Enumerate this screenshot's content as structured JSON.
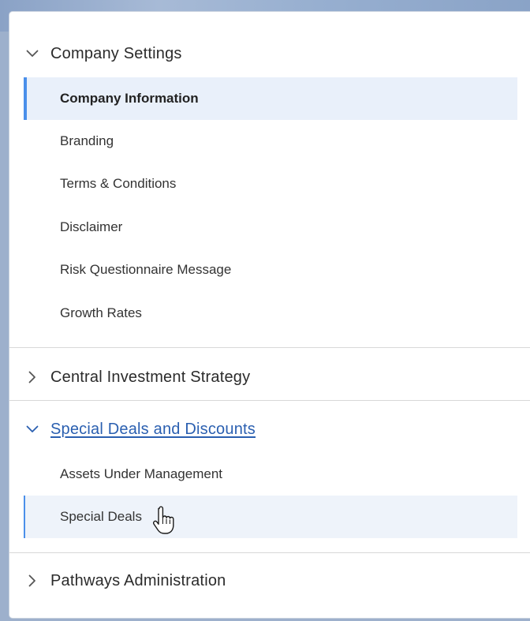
{
  "sections": [
    {
      "title": "Company Settings",
      "expanded": true,
      "items": [
        {
          "label": "Company Information",
          "state": "active"
        },
        {
          "label": "Branding"
        },
        {
          "label": "Terms & Conditions"
        },
        {
          "label": "Disclaimer"
        },
        {
          "label": "Risk Questionnaire Message"
        },
        {
          "label": "Growth Rates"
        }
      ]
    },
    {
      "title": "Central Investment Strategy",
      "expanded": false
    },
    {
      "title": "Special Deals and Discounts",
      "expanded": true,
      "is_link": true,
      "items": [
        {
          "label": "Assets Under Management"
        },
        {
          "label": "Special Deals",
          "state": "hover"
        }
      ]
    },
    {
      "title": "Pathways Administration",
      "expanded": false
    }
  ],
  "colors": {
    "accent": "#4a8fea",
    "active_bg": "#e9f0fa",
    "link": "#2a5fb0",
    "text": "#333333"
  },
  "icons": {
    "expanded": "chevron-down-icon",
    "collapsed": "chevron-right-icon",
    "cursor": "hand-pointer-icon"
  }
}
